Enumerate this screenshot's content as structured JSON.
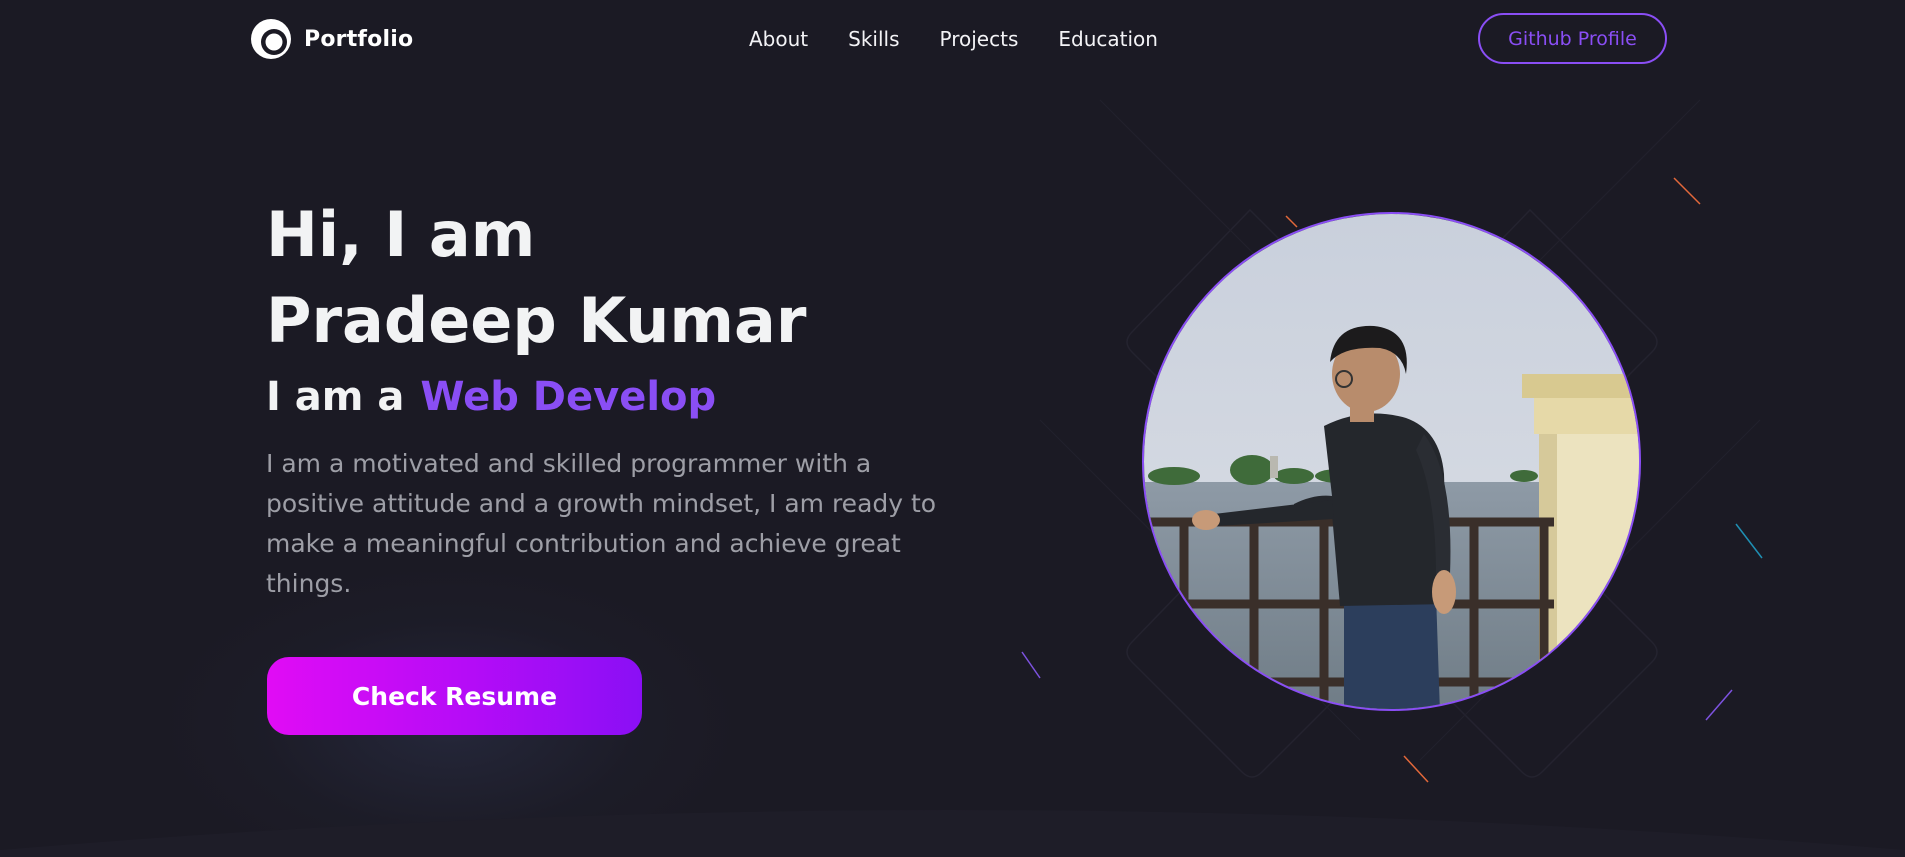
{
  "nav": {
    "logo_text": "Portfolio",
    "links": [
      "About",
      "Skills",
      "Projects",
      "Education"
    ],
    "github_label": "Github Profile"
  },
  "hero": {
    "greeting_line1": "Hi, I am",
    "greeting_line2": "Pradeep Kumar",
    "role_prefix": "I am a",
    "role_typed": "Web Develop",
    "description": "I am a motivated and skilled programmer with a positive attitude and a growth mindset, I am ready to make a meaningful contribution and achieve great things.",
    "resume_label": "Check Resume"
  },
  "colors": {
    "background": "#1b1a24",
    "accent": "#8a4ef5",
    "gradient_start": "#e10cf5",
    "gradient_end": "#8a0ff5"
  }
}
